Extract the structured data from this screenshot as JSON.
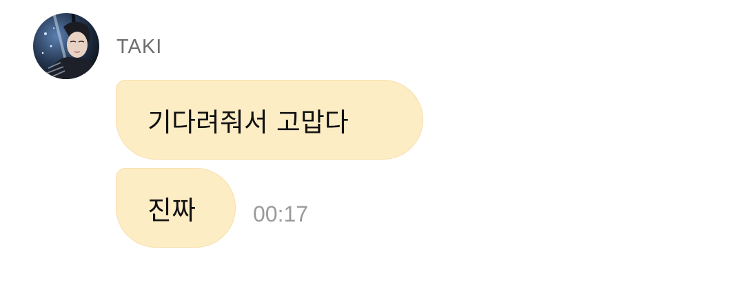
{
  "sender": {
    "name": "TAKI",
    "avatar_icon": "profile-photo"
  },
  "messages": [
    {
      "text": "기다려줘서 고맙다"
    },
    {
      "text": "진짜",
      "time": "00:17"
    }
  ],
  "colors": {
    "bubble_background": "#fdedc5",
    "bubble_border": "#f6deaa",
    "name_text": "#6e6e6e",
    "time_text": "#9a9a9a"
  }
}
